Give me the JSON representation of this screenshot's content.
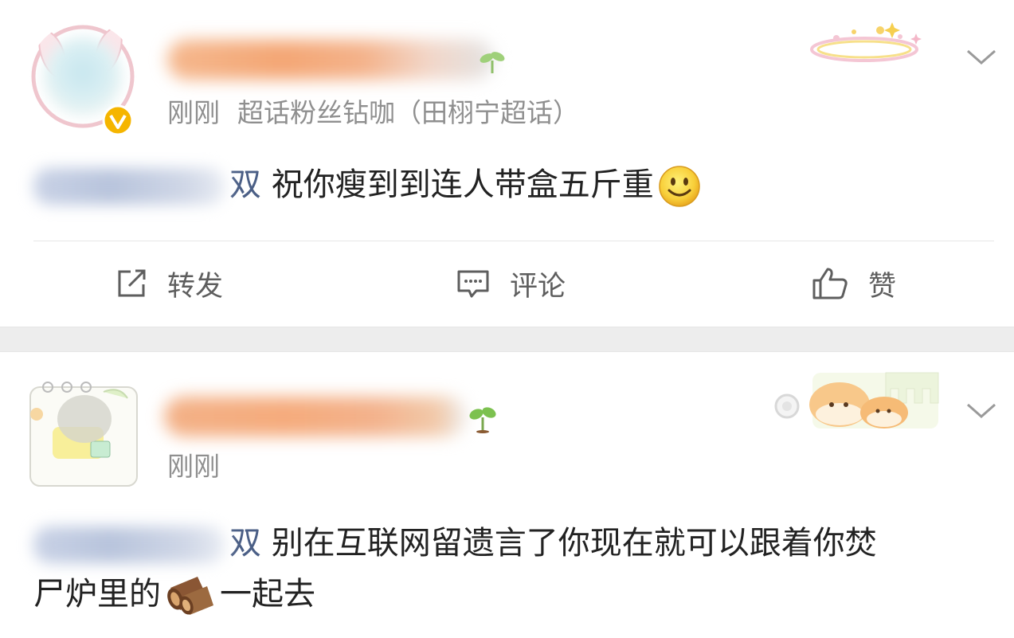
{
  "posts": [
    {
      "time": "刚刚",
      "source": "超话粉丝钻咖（田栩宁超话）",
      "mention_tail": "双",
      "text": "祝你瘦到到连人带盒五斤重",
      "emoji": "smile-emoji"
    },
    {
      "time": "刚刚",
      "mention_tail": "双",
      "text_line1": "别在互联网留遗言了你现在就可以跟着你焚",
      "text_line2_a": "尸炉里的",
      "text_line2_b": "一起去",
      "emoji": "firewood-emoji"
    }
  ],
  "actions": {
    "repost": "转发",
    "comment": "评论",
    "like": "赞"
  },
  "colors": {
    "mention": "#4b5f86",
    "username": "#f4a674",
    "meta": "#8f8f8f",
    "separator": "#ededed",
    "verified": "#f5b500"
  }
}
